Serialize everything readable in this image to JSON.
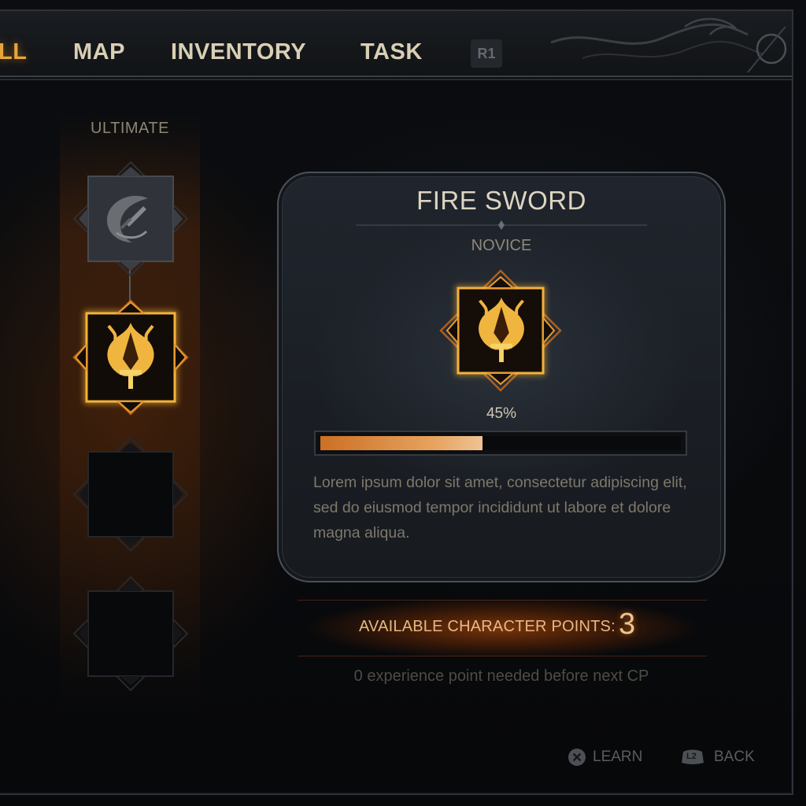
{
  "nav": {
    "tabs": [
      {
        "label": "LL",
        "active": true
      },
      {
        "label": "MAP",
        "active": false
      },
      {
        "label": "INVENTORY",
        "active": false
      },
      {
        "label": "TASK",
        "active": false
      }
    ],
    "next_button": "R1"
  },
  "skill_column": {
    "heading": "ULTIMATE",
    "slots": [
      {
        "state": "locked",
        "icon": "crescent-sword-icon"
      },
      {
        "state": "selected",
        "icon": "fire-sword-icon"
      },
      {
        "state": "empty",
        "icon": ""
      },
      {
        "state": "empty",
        "icon": ""
      }
    ]
  },
  "detail": {
    "title": "FIRE SWORD",
    "rank": "NOVICE",
    "icon": "fire-sword-icon",
    "progress": {
      "label": "45%",
      "value": 45
    },
    "description": "Lorem ipsum dolor sit amet, consectetur adipiscing elit, sed do eiusmod tempor incididunt ut labore et dolore magna aliqua."
  },
  "points": {
    "label": "AVAILABLE CHARACTER POINTS:",
    "value": "3",
    "note": "0 experience point needed before next CP"
  },
  "prompts": {
    "learn": {
      "icon": "cross-button-icon",
      "label": "LEARN"
    },
    "back": {
      "icon": "l2-button-icon",
      "badge": "L2",
      "label": "BACK"
    }
  },
  "colors": {
    "accent": "#e8a43c",
    "progress_fill": "#d98a3c",
    "glow": "#f3b23a",
    "text": "#d9cfb4"
  }
}
